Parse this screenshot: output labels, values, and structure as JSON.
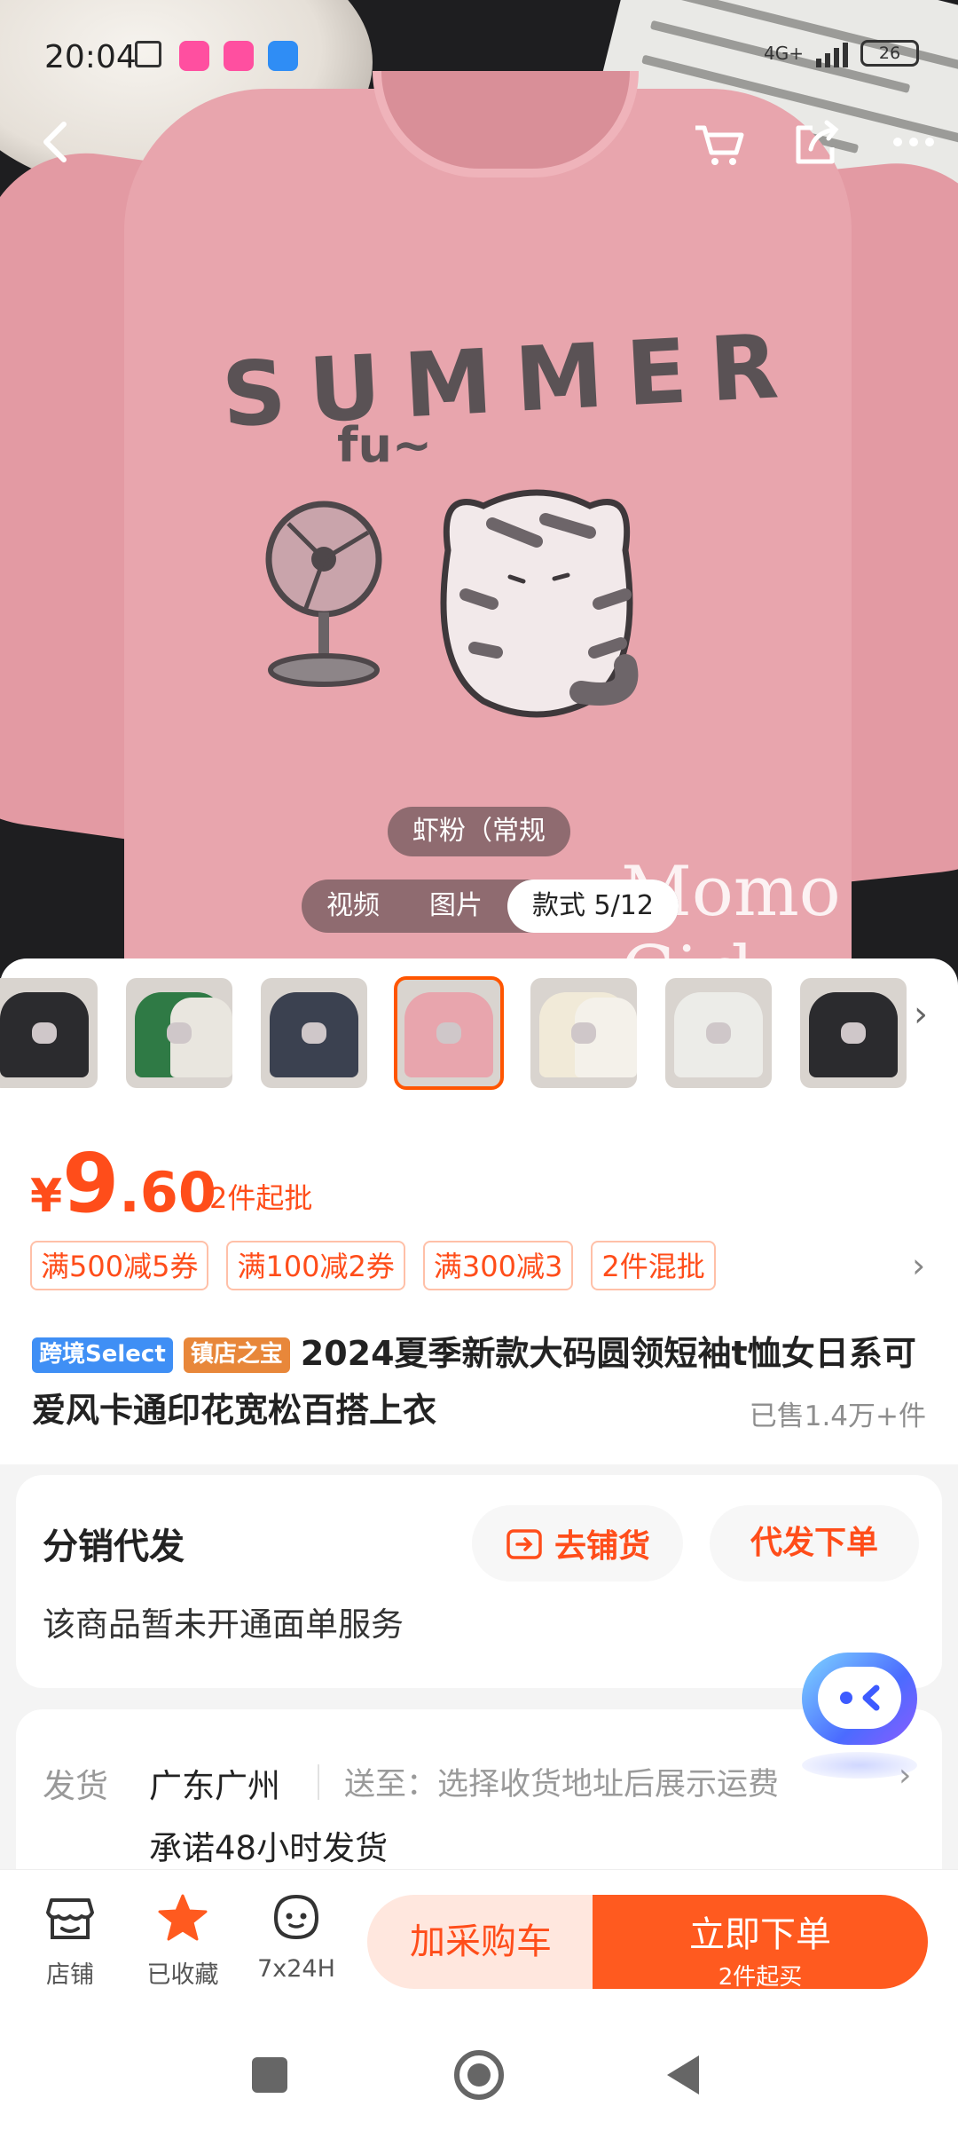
{
  "status_bar": {
    "time": "20:04",
    "network": "4G+",
    "battery": "26"
  },
  "hero": {
    "print_word": "SUMMER",
    "print_sub": "fu~",
    "watermark": "Momo Girl",
    "color_label": "虾粉（常规",
    "media_tabs": [
      {
        "label": "视频",
        "active": false
      },
      {
        "label": "图片",
        "active": false
      },
      {
        "label": "款式 5/12",
        "active": true
      }
    ]
  },
  "thumbnails": {
    "count_visible": 7,
    "selected_index": 3,
    "colors": [
      "#2b2b2e",
      "#2f7a45",
      "#3b4150",
      "#e8a5ad",
      "#f1ead8",
      "#ecece8",
      "#2b2b2e"
    ]
  },
  "price": {
    "currency": "¥",
    "integer": "9",
    "decimal": ".60",
    "min_order": "2件起批"
  },
  "coupons": [
    "满500减5券",
    "满100减2券",
    "满300减3",
    "2件混批"
  ],
  "product": {
    "tags": [
      "跨境Select",
      "镇店之宝"
    ],
    "title": "2024夏季新款大码圆领短袖t恤女日系可爱风卡通印花宽松百搭上衣",
    "sold": "已售1.4万+件"
  },
  "distribution": {
    "title": "分销代发",
    "note": "该商品暂未开通面单服务",
    "distribute_label": "去铺货",
    "dropship_label": "代发下单"
  },
  "shipping": {
    "label": "发货",
    "from": "广东广州",
    "to": "送至：选择收货地址后展示运费",
    "promise": "承诺48小时发货"
  },
  "bottom_bar": {
    "store_label": "店铺",
    "favorite_label": "已收藏",
    "service_label": "7x24H",
    "add_cart_label": "加采购车",
    "buy_now_label": "立即下单",
    "buy_now_sub": "2件起买"
  },
  "colors": {
    "accent": "#ff4d1a",
    "buy_now": "#ff5a1f",
    "add_cart_bg": "#ffe7de"
  }
}
